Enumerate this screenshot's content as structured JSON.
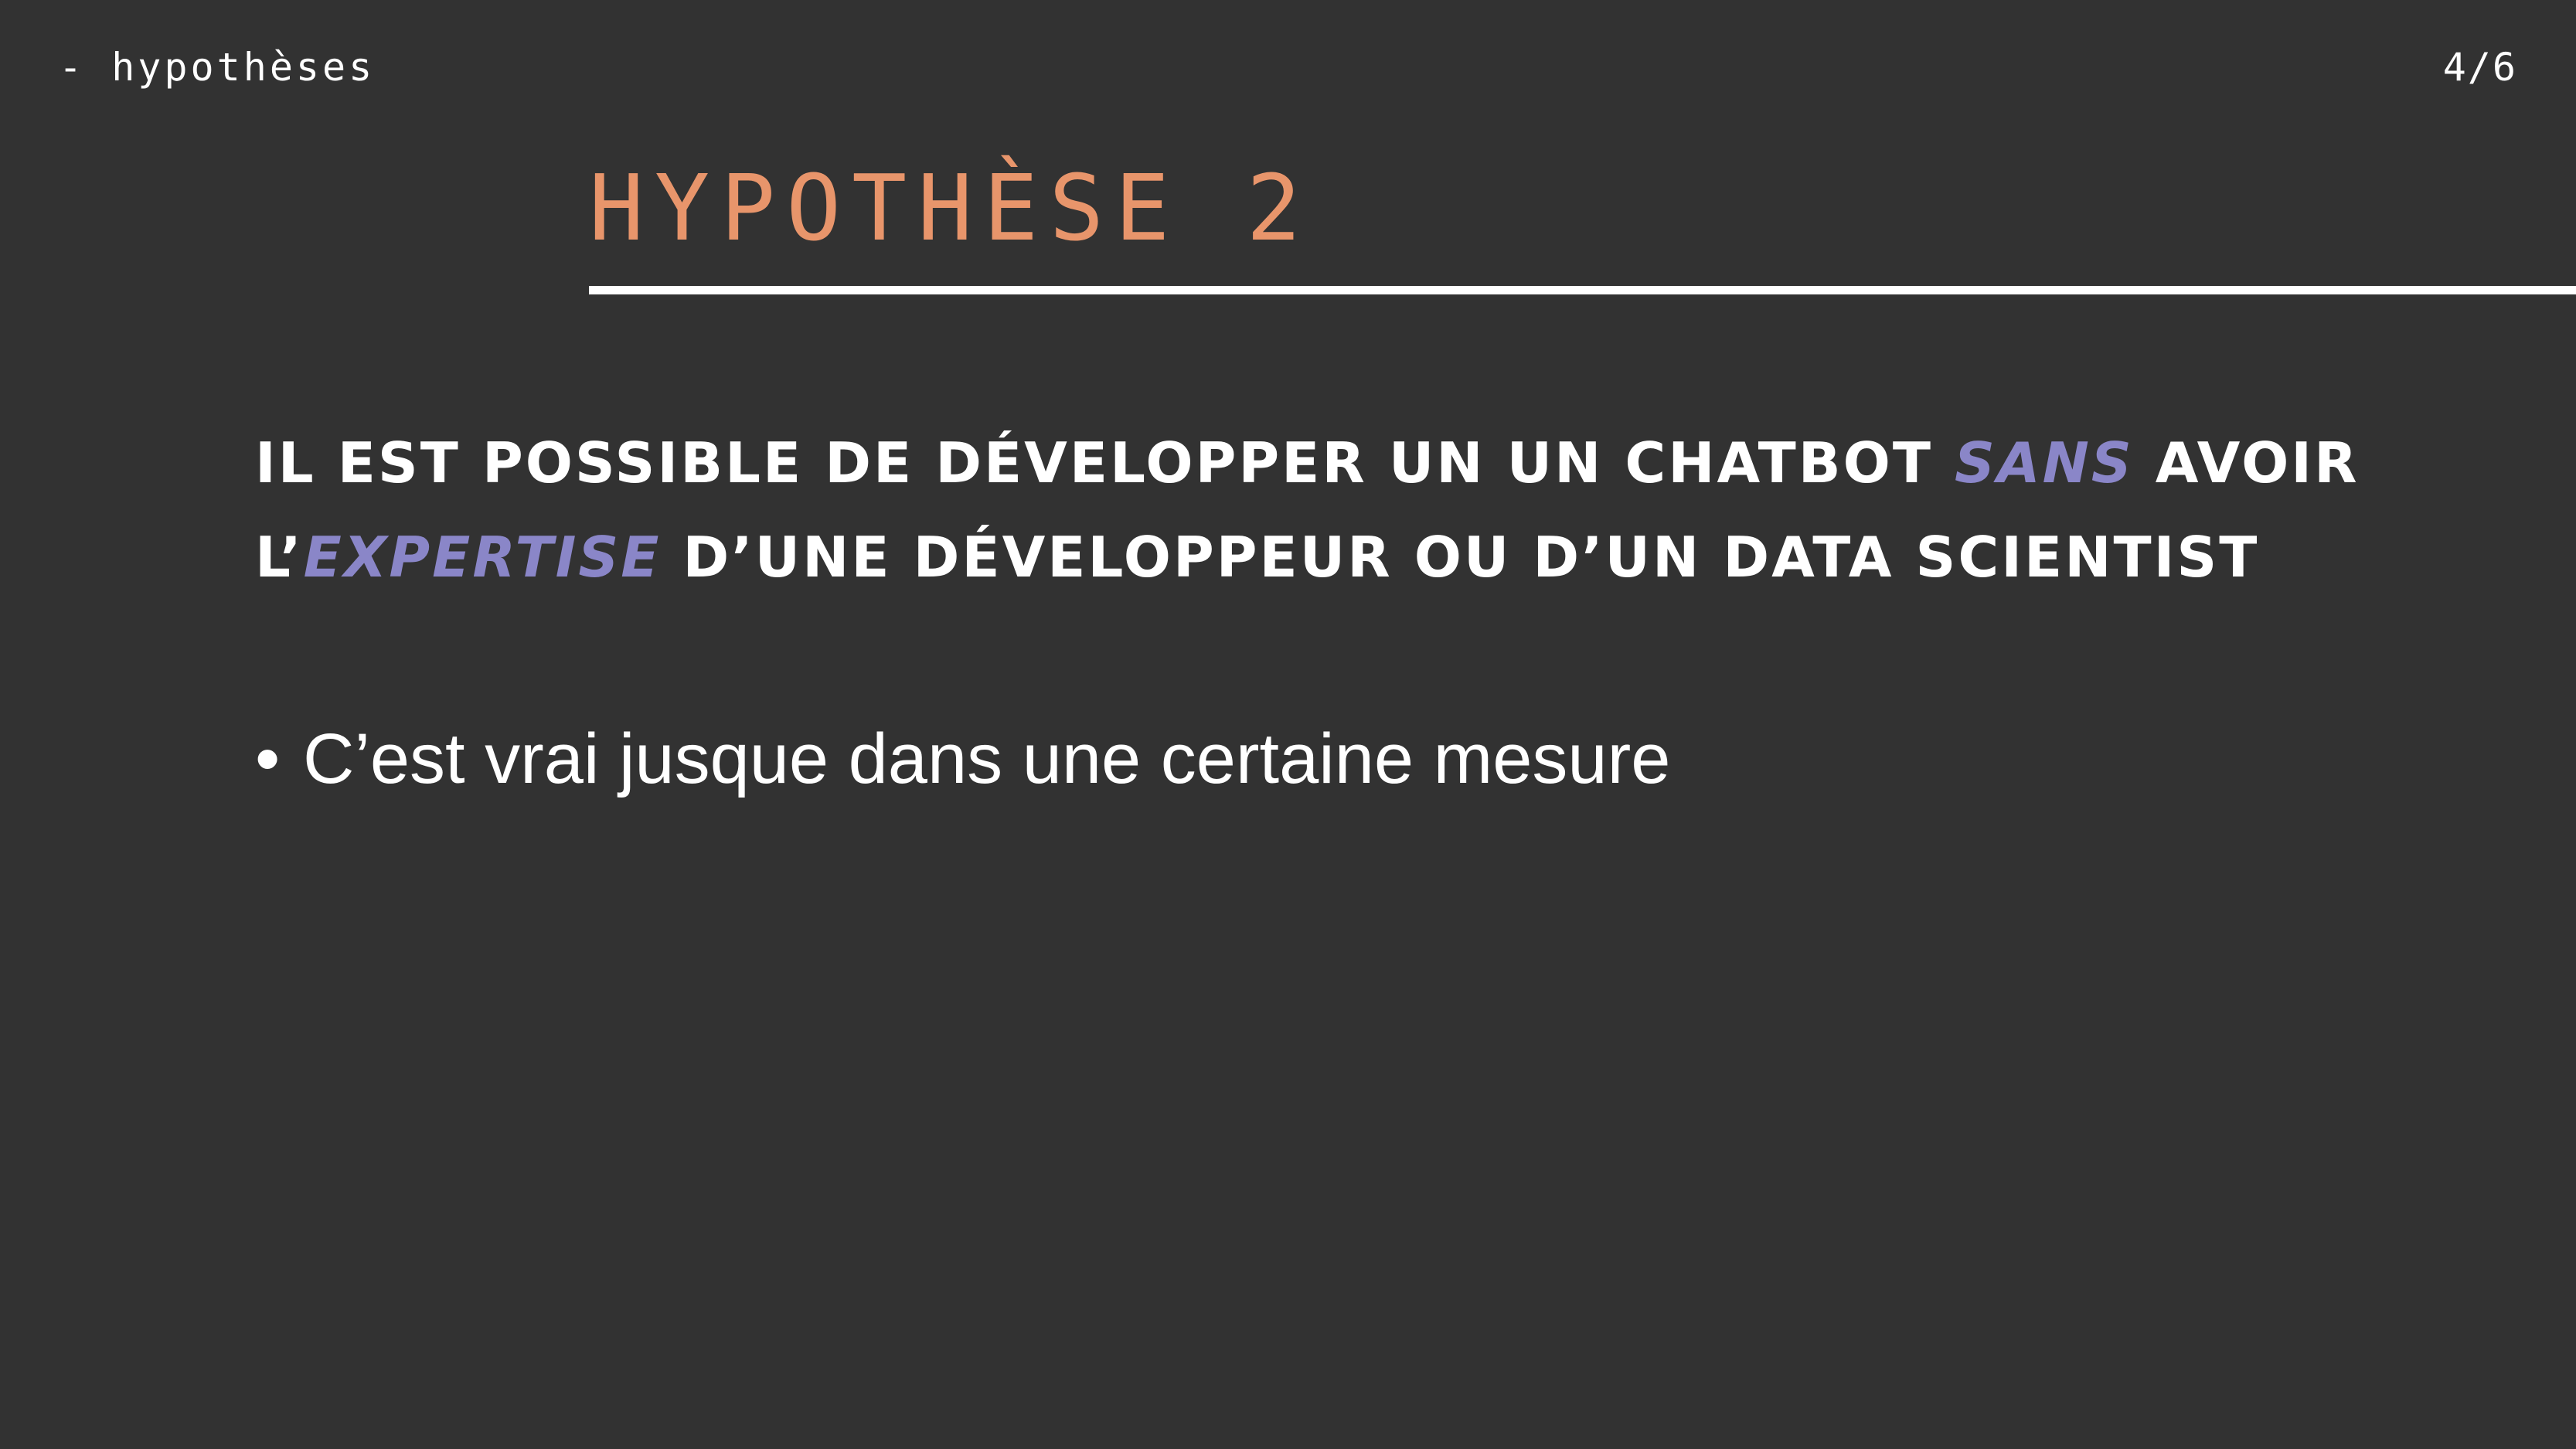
{
  "header": {
    "section_label": "- hypothèses",
    "page_number": "4/6"
  },
  "slide": {
    "title": "HYPOTHÈSE 2",
    "hypothesis": {
      "part1": "Il est possible de développer un un chatbot ",
      "emph1": "sans",
      "part2": " avoir",
      "part3": "l’",
      "emph2": "expertise",
      "part4": " d’une développeur ou d’un data scientist"
    },
    "bullets": [
      {
        "marker": "•",
        "text": "C’est vrai jusque dans une certaine mesure"
      }
    ]
  },
  "colors": {
    "background": "#323232",
    "title": "#e8956b",
    "emphasis": "#8a86c8",
    "text": "#ffffff"
  }
}
